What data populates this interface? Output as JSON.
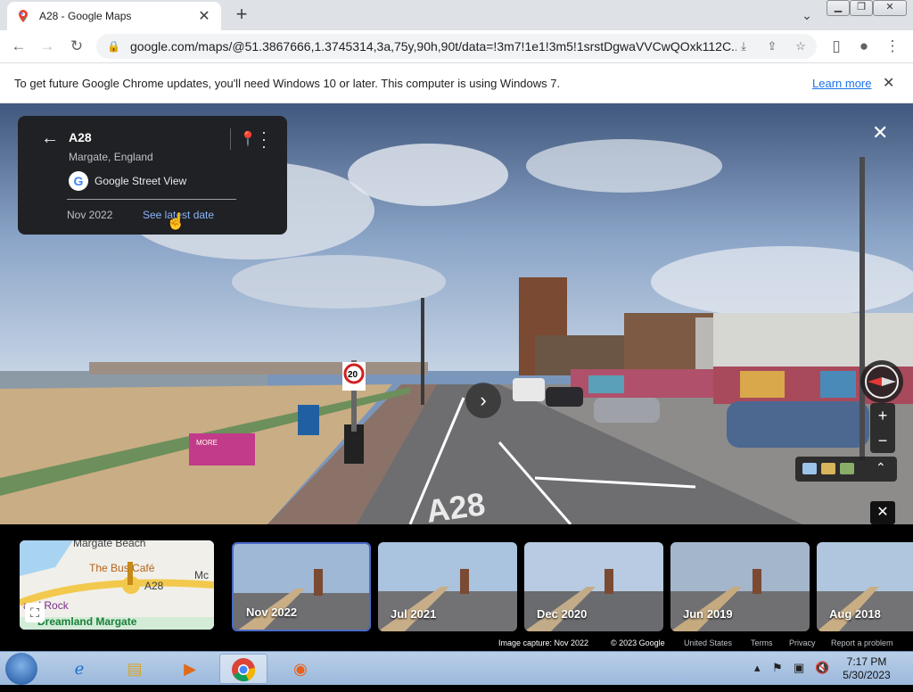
{
  "browser": {
    "tab_title": "A28 - Google Maps",
    "url": "google.com/maps/@51.3867666,1.3745314,3a,75y,90h,90t/data=!3m7!1e1!3m5!1srstDgwaVVCwQOxk112C...",
    "infobar_message": "To get future Google Chrome updates, you'll need Windows 10 or later. This computer is using Windows 7.",
    "infobar_link": "Learn more"
  },
  "card": {
    "title": "A28",
    "subtitle": "Margate, England",
    "provider": "Google Street View",
    "date": "Nov 2022",
    "latest_link": "See latest date"
  },
  "minimap": {
    "labels": [
      "Margate Beach",
      "The Bus Café",
      "A28",
      "Mc",
      "Dreamland Margate",
      "and Rock"
    ]
  },
  "timeline": {
    "thumbnails": [
      {
        "label": "Nov 2022",
        "selected": true
      },
      {
        "label": "Jul 2021",
        "selected": false
      },
      {
        "label": "Dec 2020",
        "selected": false
      },
      {
        "label": "Jun 2019",
        "selected": false
      },
      {
        "label": "Aug 2018",
        "selected": false
      }
    ],
    "footer": {
      "capture": "Image capture: Nov 2022",
      "copyright": "© 2023 Google",
      "country": "United States",
      "terms": "Terms",
      "privacy": "Privacy",
      "report": "Report a problem"
    }
  },
  "street": {
    "road_sign": "20",
    "road_marking": "A28",
    "kiosk_sign": "MORE"
  },
  "taskbar": {
    "time": "7:17 PM",
    "date": "5/30/2023"
  },
  "colors": {
    "accent": "#1a73e8",
    "card_bg": "#202124",
    "link_dark": "#8ab4f8"
  }
}
